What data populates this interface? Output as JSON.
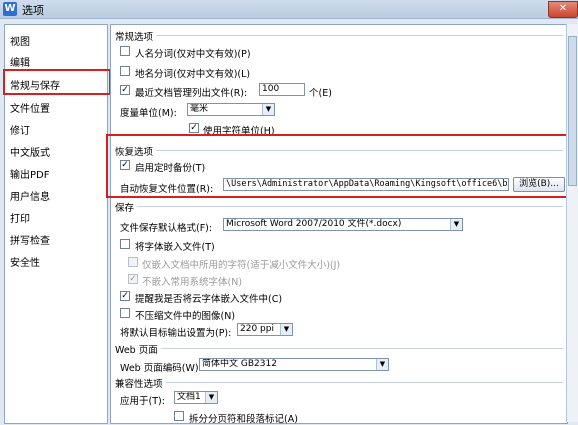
{
  "window": {
    "title": "选项",
    "app_icon_letter": "W",
    "close_glyph": "✕"
  },
  "sidebar": {
    "items": [
      "视图",
      "编辑",
      "常规与保存",
      "文件位置",
      "修订",
      "中文版式",
      "输出PDF",
      "用户信息",
      "打印",
      "拼写检查",
      "安全性"
    ],
    "selected_index": 2
  },
  "general": {
    "section_title": "常规选项",
    "person_name_split": "人名分词(仅对中文有效)(P)",
    "place_name_split": "地名分词(仅对中文有效)(L)",
    "recent_files_label": "最近文档管理列出文件(R):",
    "recent_files_value": "100",
    "recent_files_unit": "个(E)",
    "measure_unit_label": "度量单位(M):",
    "measure_unit_value": "毫米",
    "use_char_unit": "使用字符单位(H)"
  },
  "recovery": {
    "section_title": "恢复选项",
    "enable_backup": "启用定时备份(T)",
    "location_label": "自动恢复文件位置(R):",
    "location_value": "\\Users\\Administrator\\AppData\\Roaming\\Kingsoft\\office6\\backup",
    "browse_button": "浏览(B)..."
  },
  "save": {
    "section_title": "保存",
    "default_format_label": "文件保存默认格式(F):",
    "default_format_value": "Microsoft Word 2007/2010 文件(*.docx)",
    "embed_fonts": "将字体嵌入文件(T)",
    "embed_used_chars": "仅嵌入文档中所用的字符(适于减小文件大小)(J)",
    "no_embed_common": "不嵌入常用系统字体(N)",
    "remind_cloud_fonts": "提醒我是否将云字体嵌入文件中(C)",
    "no_compress_images": "不压缩文件中的图像(N)",
    "default_output_label": "将默认目标输出设置为(P):",
    "default_output_value": "220 ppi"
  },
  "web": {
    "section_title": "Web 页面",
    "encoding_label": "Web 页面编码(W):",
    "encoding_value": "简体中文 GB2312"
  },
  "compat": {
    "section_title": "兼容性选项",
    "apply_to_label": "应用于(T):",
    "apply_to_value": "文档1",
    "split_marks": "拆分分页符和段落标记(A)"
  },
  "glyphs": {
    "check": "✓",
    "dropdown": "▼"
  },
  "colors": {
    "highlight_red": "#d62020",
    "frame_blue": "#8fa5c2"
  }
}
